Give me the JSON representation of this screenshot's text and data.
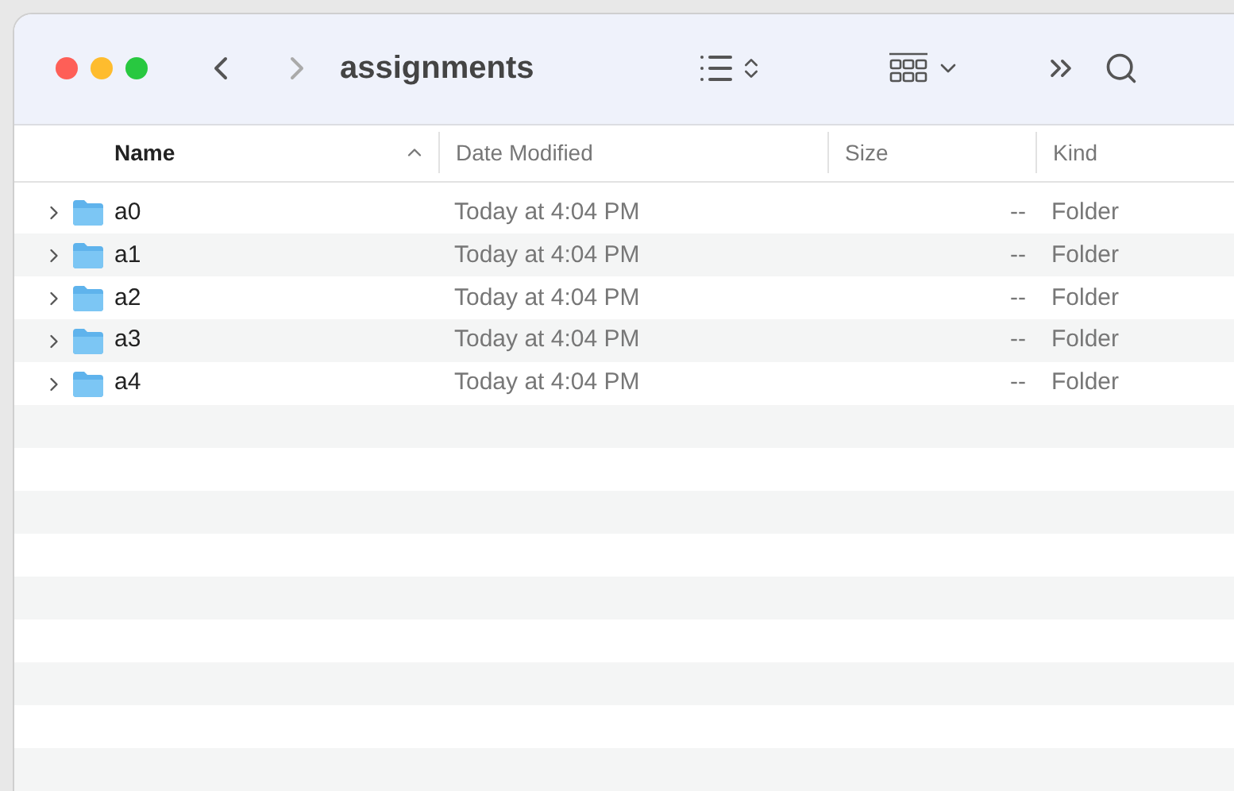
{
  "window": {
    "title": "assignments"
  },
  "table": {
    "columns": [
      {
        "label": "Name",
        "sorted": true
      },
      {
        "label": "Date Modified",
        "sorted": false
      },
      {
        "label": "Size",
        "sorted": false
      },
      {
        "label": "Kind",
        "sorted": false
      }
    ],
    "rows": [
      {
        "name": "a0",
        "date": "Today at 4:04 PM",
        "size": "--",
        "kind": "Folder",
        "expanded": false
      },
      {
        "name": "a1",
        "date": "Today at 4:04 PM",
        "size": "--",
        "kind": "Folder",
        "expanded": false
      },
      {
        "name": "a2",
        "date": "Today at 4:04 PM",
        "size": "--",
        "kind": "Folder",
        "expanded": false
      },
      {
        "name": "a3",
        "date": "Today at 4:04 PM",
        "size": "--",
        "kind": "Folder",
        "expanded": false
      },
      {
        "name": "a4",
        "date": "Today at 4:04 PM",
        "size": "--",
        "kind": "Folder",
        "expanded": false
      }
    ]
  }
}
